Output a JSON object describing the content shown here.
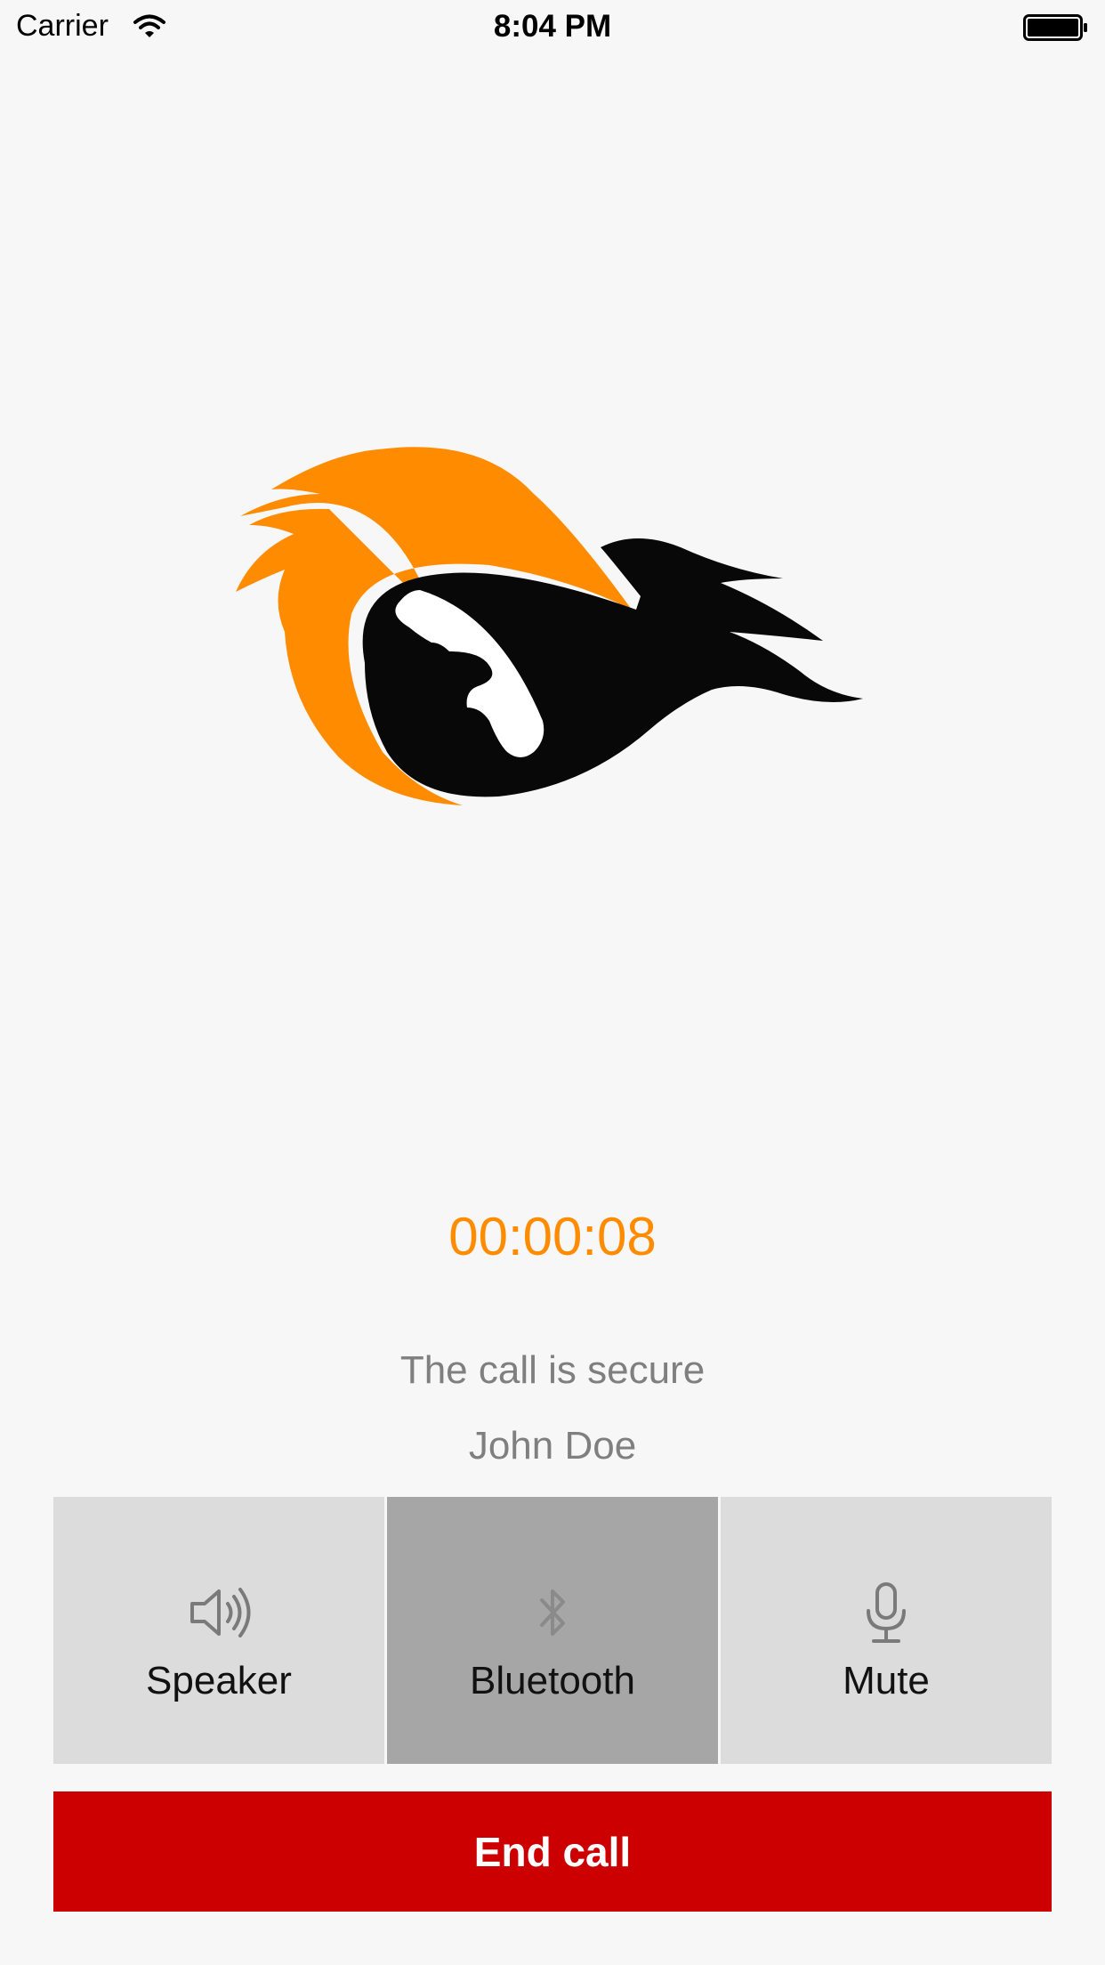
{
  "status_bar": {
    "carrier": "Carrier",
    "time": "8:04 PM"
  },
  "logo": {
    "icon": "flaming-phone-logo",
    "colors": {
      "flame": "#ff8c00",
      "body": "#080808"
    }
  },
  "call": {
    "timer": "00:00:08",
    "security_status": "The call is secure",
    "caller_name": "John Doe"
  },
  "controls": [
    {
      "label": "Speaker",
      "icon": "speaker-icon",
      "active": false
    },
    {
      "label": "Bluetooth",
      "icon": "bluetooth-icon",
      "active": true
    },
    {
      "label": "Mute",
      "icon": "microphone-icon",
      "active": false
    }
  ],
  "end_call": {
    "label": "End call",
    "color": "#cc0000"
  },
  "colors": {
    "accent": "#ff8c00",
    "background": "#f7f7f7",
    "button": "#dcdcdc",
    "button_active": "#a6a6a6"
  }
}
